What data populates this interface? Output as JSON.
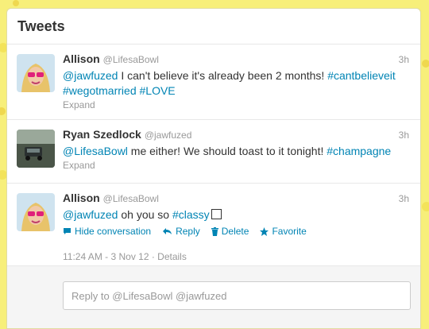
{
  "panel": {
    "title": "Tweets"
  },
  "tweets": [
    {
      "fullname": "Allison",
      "username": "@LifesaBowl",
      "time": "3h",
      "mention": "@jawfuzed",
      "text": " I can't believe it's already been 2 months! ",
      "hashtag1": "#cantbelieveit",
      "hashtag2": "#wegotmarried",
      "hashtag3": "#LOVE",
      "expand": "Expand"
    },
    {
      "fullname": "Ryan Szedlock",
      "username": "@jawfuzed",
      "time": "3h",
      "mention": "@LifesaBowl",
      "text": " me either! We should toast to it tonight! ",
      "hashtag1": "#champagne",
      "expand": "Expand"
    },
    {
      "fullname": "Allison",
      "username": "@LifesaBowl",
      "time": "3h",
      "mention": "@jawfuzed",
      "text": " oh you so ",
      "hashtag1": "#classy",
      "actions": {
        "hide": "Hide conversation",
        "reply": "Reply",
        "delete": "Delete",
        "favorite": "Favorite"
      },
      "meta": "11:24 AM - 3 Nov 12 · Details"
    }
  ],
  "reply": {
    "placeholder": "Reply to @LifesaBowl @jawfuzed"
  },
  "colors": {
    "link": "#0084b4",
    "background": "#f7ef7a"
  }
}
